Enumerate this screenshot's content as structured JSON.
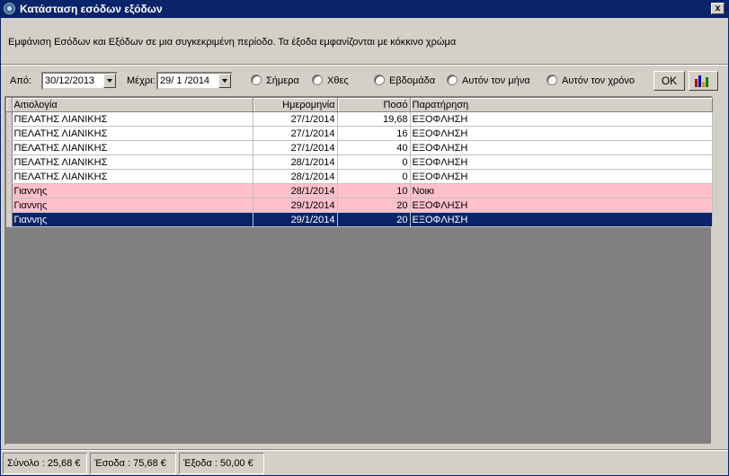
{
  "window": {
    "title": "Κατάσταση εσόδων εξόδων",
    "close_label": "x"
  },
  "description": "Εμφάνιση Εσόδων και Εξόδων σε μια συγκεκριμένη περίοδο. Τα έξοδα εμφανίζονται με κόκκινο χρώμα",
  "filter": {
    "from_label": "Από:",
    "from_value": "30/12/2013",
    "to_label": "Μέχρι:",
    "to_value": "29/ 1 /2014",
    "radios": [
      "Σήμερα",
      "Χθες",
      "Εβδομάδα",
      "Αυτόν τον μήνα",
      "Αυτόν τον χρόνο"
    ],
    "ok_label": "OK",
    "chart_icon": "bar-chart-icon"
  },
  "grid": {
    "columns": [
      "Αιτιολογία",
      "Ημερομηνία",
      "Ποσό",
      "Παρατήρηση"
    ],
    "rows": [
      [
        "ΠΕΛΑΤΗΣ ΛΙΑΝΙΚΗΣ",
        "27/1/2014",
        "19,68",
        "ΕΞΟΦΛΗΣΗ"
      ],
      [
        "ΠΕΛΑΤΗΣ ΛΙΑΝΙΚΗΣ",
        "27/1/2014",
        "16",
        "ΕΞΟΦΛΗΣΗ"
      ],
      [
        "ΠΕΛΑΤΗΣ ΛΙΑΝΙΚΗΣ",
        "27/1/2014",
        "40",
        "ΕΞΟΦΛΗΣΗ"
      ],
      [
        "ΠΕΛΑΤΗΣ ΛΙΑΝΙΚΗΣ",
        "28/1/2014",
        "0",
        "ΕΞΟΦΛΗΣΗ"
      ],
      [
        "ΠΕΛΑΤΗΣ ΛΙΑΝΙΚΗΣ",
        "28/1/2014",
        "0",
        "ΕΞΟΦΛΗΣΗ"
      ],
      [
        "Γιαννης",
        "28/1/2014",
        "10",
        "Νοικι"
      ],
      [
        "Γιαννης",
        "29/1/2014",
        "20",
        "ΕΞΟΦΛΗΣΗ"
      ],
      [
        "Γιαννης",
        "29/1/2014",
        "20",
        "ΕΞΟΦΛΗΣΗ"
      ]
    ],
    "row_styles": [
      "white",
      "white",
      "white",
      "white",
      "white",
      "pink",
      "pink",
      "sel"
    ]
  },
  "status": {
    "total": "Σύνολο : 25,68 €",
    "income": "Έσοδα : 75,68 €",
    "expenses": "Έξοδα : 50,00 €"
  },
  "colors": {
    "titlebar": "#0a246a",
    "expense_row": "#ffc0cb",
    "selected_row": "#0a246a"
  }
}
